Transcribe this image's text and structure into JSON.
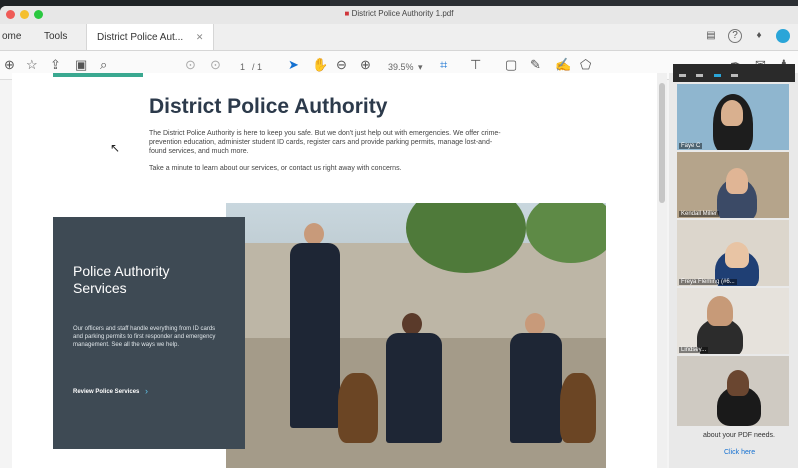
{
  "window": {
    "document_title": "District Police Authority 1.pdf"
  },
  "tabs": {
    "home": "ome",
    "tools": "Tools",
    "document": "District Police Aut..."
  },
  "toolbar": {
    "page_current": "1",
    "page_total": "/ 1",
    "zoom": "39.5%"
  },
  "page": {
    "title": "District Police Authority",
    "intro": "The District Police Authority is here to keep you safe. But we don't just help out with emergencies. We offer crime-prevention education, administer student ID cards, register cars and provide parking permits, manage lost-and-found services, and much more.",
    "intro2": "Take a minute to learn about our services, or contact us right away with concerns.",
    "services_card": {
      "title": "Police Authority Services",
      "body": "Our officers and staff handle everything from ID cards and parking permits to first responder and emergency management. See all the ways we help.",
      "link": "Review Police Services"
    }
  },
  "video_call": {
    "participants": [
      {
        "name": "Faye C"
      },
      {
        "name": "Kendall Miller"
      },
      {
        "name": "Freya Fleming (#6... "
      },
      {
        "name": "Lindsey..."
      },
      {
        "name": ""
      }
    ],
    "help_text": "about your PDF needs.",
    "help_link": "Click here"
  },
  "colors": {
    "accent_teal": "#3aa890",
    "card_bg": "#3e4a54",
    "link_blue": "#1470d1"
  }
}
